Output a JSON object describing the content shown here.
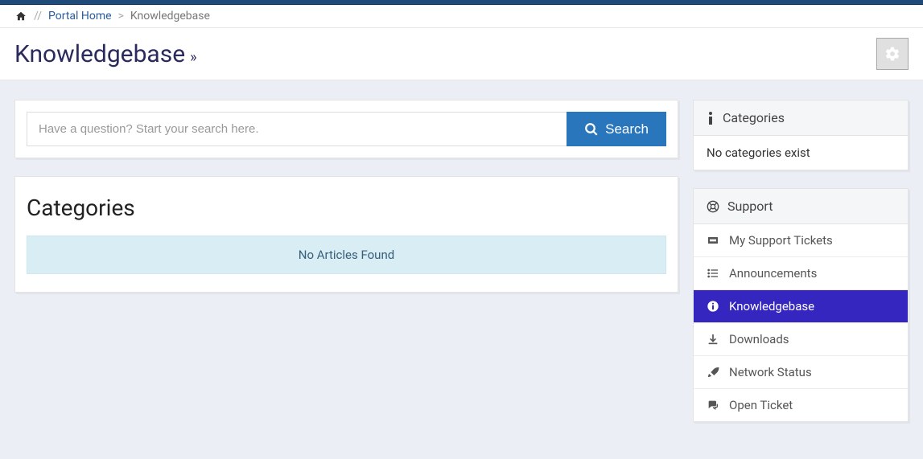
{
  "breadcrumb": {
    "home_link": "Portal Home",
    "current": "Knowledgebase"
  },
  "page": {
    "title": "Knowledgebase"
  },
  "search": {
    "placeholder": "Have a question? Start your search here.",
    "button_label": "Search"
  },
  "main": {
    "categories_heading": "Categories",
    "no_articles": "No Articles Found"
  },
  "sidebar": {
    "categories_header": "Categories",
    "categories_empty": "No categories exist",
    "support_header": "Support",
    "items": [
      {
        "label": "My Support Tickets",
        "active": false
      },
      {
        "label": "Announcements",
        "active": false
      },
      {
        "label": "Knowledgebase",
        "active": true
      },
      {
        "label": "Downloads",
        "active": false
      },
      {
        "label": "Network Status",
        "active": false
      },
      {
        "label": "Open Ticket",
        "active": false
      }
    ]
  }
}
